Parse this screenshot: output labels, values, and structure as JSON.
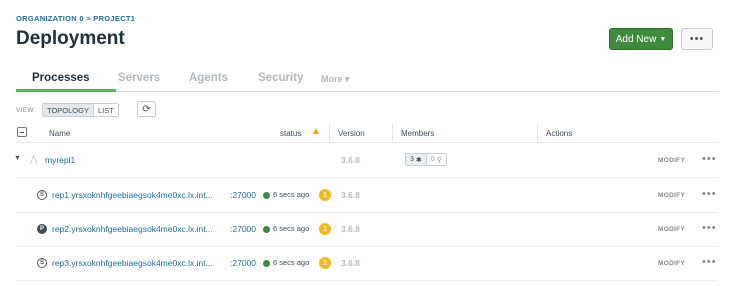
{
  "breadcrumb": {
    "org": "ORGANIZATION 0",
    "sep": ">",
    "project": "PROJECT1"
  },
  "page_title": "Deployment",
  "actions": {
    "add_new": "Add New",
    "more": "•••"
  },
  "tabs": [
    {
      "label": "Processes",
      "active": true
    },
    {
      "label": "Servers",
      "active": false
    },
    {
      "label": "Agents",
      "active": false
    },
    {
      "label": "Security",
      "active": false
    }
  ],
  "tab_more": "More ▾",
  "view": {
    "label": "VIEW:",
    "options": [
      "TOPOLOGY",
      "LIST"
    ],
    "selected": "TOPOLOGY"
  },
  "table": {
    "headers": {
      "name": "Name",
      "status": "status",
      "version": "Version",
      "members": "Members",
      "actions": "Actions"
    },
    "replica_set": {
      "name": "myrepl1",
      "version": "3.6.8",
      "members_count": "3",
      "arbiters_count": "0",
      "modify": "MODIFY",
      "menu": "•••"
    },
    "processes": [
      {
        "role": "S",
        "name": "rep1.yrsxoknhfgeebiaegsok4me0xc.lx.int...",
        "port": ":27000",
        "status_time": "6 secs ago",
        "warnings": "1",
        "version": "3.6.8",
        "modify": "MODIFY",
        "menu": "•••"
      },
      {
        "role": "P",
        "name": "rep2.yrsxoknhfgeebiaegsok4me0xc.lx.int...",
        "port": ":27000",
        "status_time": "6 secs ago",
        "warnings": "1",
        "version": "3.6.8",
        "modify": "MODIFY",
        "menu": "•••"
      },
      {
        "role": "S",
        "name": "rep3.yrsxoknhfgeebiaegsok4me0xc.lx.int...",
        "port": ":27000",
        "status_time": "6 secs ago",
        "warnings": "1",
        "version": "3.6.8",
        "modify": "MODIFY",
        "menu": "•••"
      }
    ]
  },
  "colors": {
    "primary_green": "#3f8a3c",
    "link_blue": "#1a6ea8",
    "warning_yellow": "#f5ba1f",
    "tab_underline": "#58b55f"
  }
}
